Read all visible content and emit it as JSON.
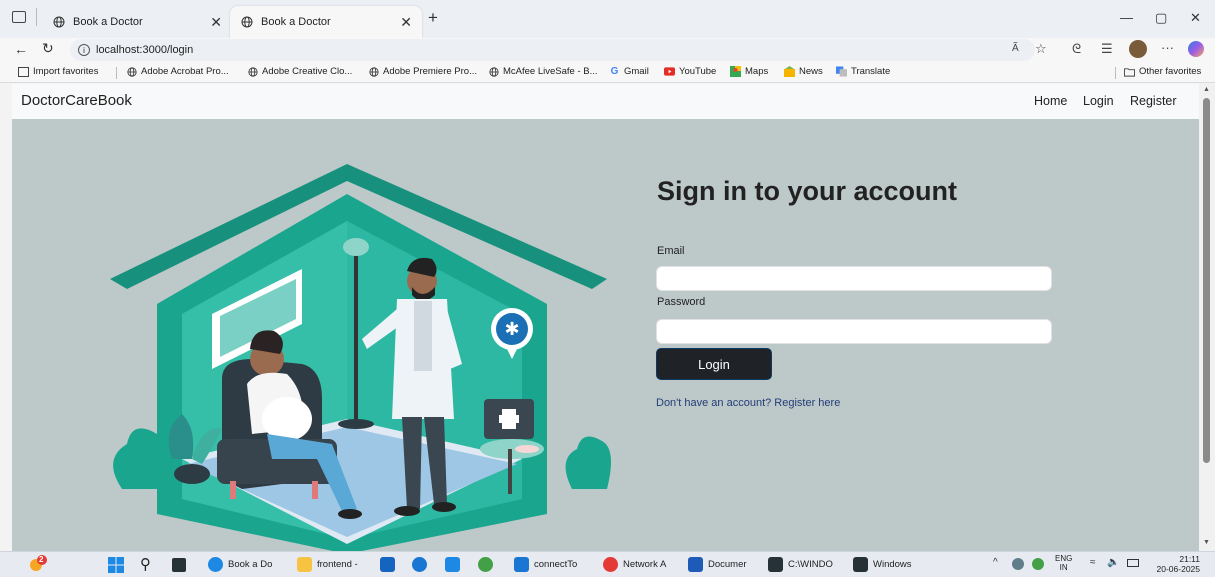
{
  "browser": {
    "tabs": [
      {
        "label": "Book a Doctor",
        "active": false
      },
      {
        "label": "Book a Doctor",
        "active": true
      }
    ],
    "url": "localhost:3000/login",
    "favorites": [
      {
        "label": "Import favorites",
        "icon": "import-icon"
      },
      {
        "label": "Adobe Acrobat Pro...",
        "icon": "globe-icon"
      },
      {
        "label": "Adobe Creative Clo...",
        "icon": "globe-icon"
      },
      {
        "label": "Adobe Premiere Pro...",
        "icon": "globe-icon"
      },
      {
        "label": "McAfee LiveSafe - B...",
        "icon": "globe-icon"
      },
      {
        "label": "Gmail",
        "icon": "google-icon"
      },
      {
        "label": "YouTube",
        "icon": "youtube-icon"
      },
      {
        "label": "Maps",
        "icon": "maps-icon"
      },
      {
        "label": "News",
        "icon": "news-icon"
      },
      {
        "label": "Translate",
        "icon": "translate-icon"
      }
    ],
    "other_favorites": "Other favorites"
  },
  "site": {
    "brand": "DoctorCareBook",
    "nav": {
      "home": "Home",
      "login": "Login",
      "register": "Register"
    }
  },
  "login": {
    "title": "Sign in to your account",
    "email_label": "Email",
    "email_value": "",
    "password_label": "Password",
    "password_value": "",
    "submit": "Login",
    "register_link": "Don't have an account? Register here"
  },
  "taskbar": {
    "weather_badge": "2",
    "items": [
      {
        "label": "Book a Do",
        "color": "#1e88e5"
      },
      {
        "label": "frontend -",
        "color": "#f6c343"
      },
      {
        "label": "",
        "color": "#1565c0"
      },
      {
        "label": "",
        "color": "#1976d2"
      },
      {
        "label": "",
        "color": "#1e88e5"
      },
      {
        "label": "",
        "color": "#43a047"
      },
      {
        "label": "connectTo",
        "color": "#1976d2"
      },
      {
        "label": "Network A",
        "color": "#e53935"
      },
      {
        "label": "Documer",
        "color": "#1e5bb8"
      },
      {
        "label": "C:\\WINDO",
        "color": "#263238"
      },
      {
        "label": "Windows",
        "color": "#263238"
      }
    ],
    "lang": "ENG",
    "lang_sub": "IN",
    "time": "21:11",
    "date": "20-06-2025"
  },
  "colors": {
    "hero_bg": "#bdc9c8",
    "house_teal": "#1aa58f",
    "button_bg": "#1f2328"
  }
}
